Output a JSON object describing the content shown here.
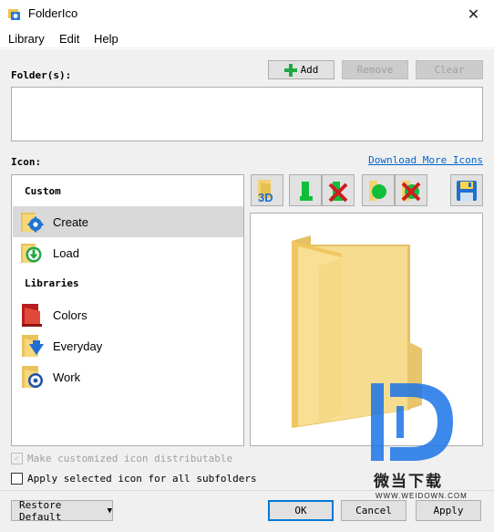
{
  "window": {
    "title": "FolderIco",
    "close_glyph": "✕"
  },
  "menu": {
    "items": [
      "Library",
      "Edit",
      "Help"
    ]
  },
  "folders": {
    "label": "Folder(s):",
    "add_label": "Add",
    "remove_label": "Remove",
    "clear_label": "Clear"
  },
  "icon": {
    "label": "Icon:",
    "download_link": "Download More Icons"
  },
  "list": {
    "custom_header": "Custom",
    "custom_items": [
      {
        "label": "Create",
        "icon": "folder-gear-icon",
        "selected": true
      },
      {
        "label": "Load",
        "icon": "load-icon",
        "selected": false
      }
    ],
    "libraries_header": "Libraries",
    "library_items": [
      {
        "label": "Colors",
        "icon": "red-folder-icon"
      },
      {
        "label": "Everyday",
        "icon": "folder-arrow-icon"
      },
      {
        "label": "Work",
        "icon": "folder-gear-icon"
      }
    ]
  },
  "toolbar": {
    "buttons": [
      "3d-icon",
      "left-half-icon",
      "remove-left-icon",
      "right-half-icon",
      "remove-right-icon",
      "save-icon"
    ],
    "3d_text": "3D"
  },
  "options": {
    "distributable_label": "Make customized icon distributable",
    "distributable_checked": true,
    "distributable_enabled": false,
    "subfolders_label": "Apply selected icon for all subfolders",
    "subfolders_checked": false
  },
  "footer": {
    "restore_label": "Restore Default",
    "ok_label": "OK",
    "cancel_label": "Cancel",
    "apply_label": "Apply"
  },
  "watermark": {
    "brand_cn": "微当下载",
    "url": "WWW.WEIDOWN.COM"
  },
  "colors": {
    "accent": "#0078d7",
    "link": "#0066cc",
    "folder_yellow": "#f3d275",
    "green": "#21a843",
    "red": "#cc1f1f"
  }
}
